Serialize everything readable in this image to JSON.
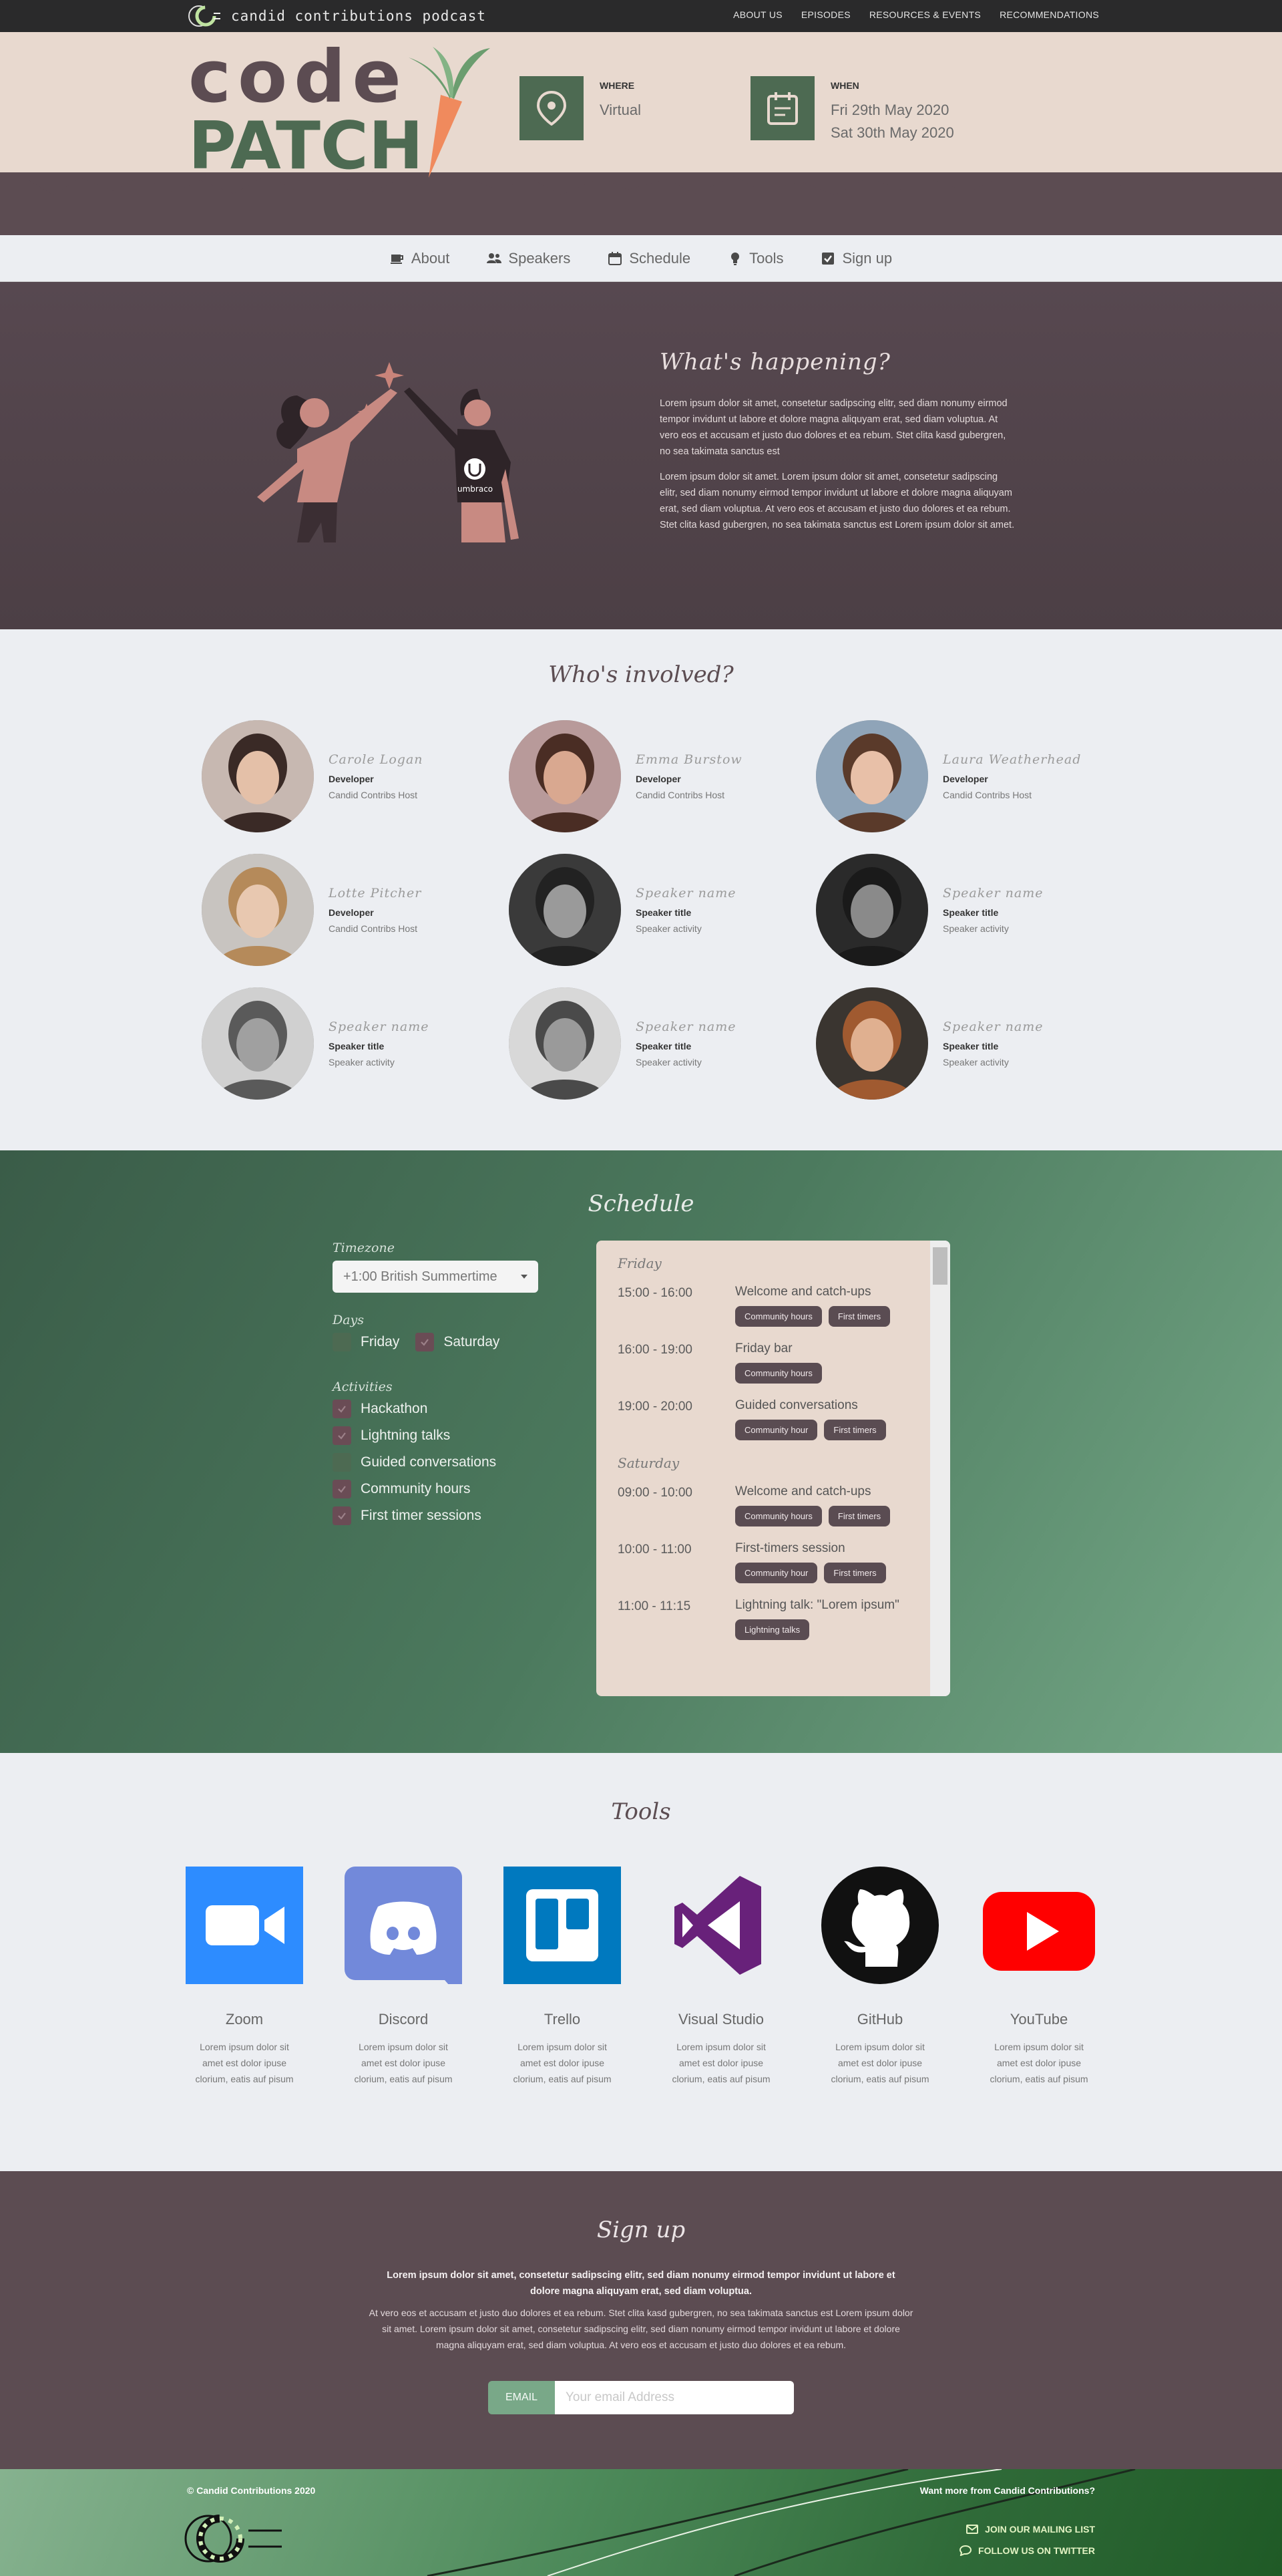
{
  "topbar": {
    "brand": "candid contributions podcast",
    "nav": [
      "About us",
      "Episodes",
      "Resources & events",
      "Recommendations"
    ]
  },
  "header": {
    "logo_text_1": "code",
    "logo_text_2": "PATCH",
    "where_label": "Where",
    "where_value": "Virtual",
    "when_label": "When",
    "when_values": [
      "Fri 29th May 2020",
      "Sat 30th May 2020"
    ]
  },
  "subnav": {
    "items": [
      {
        "label": "About",
        "icon": "coffee-icon"
      },
      {
        "label": "Speakers",
        "icon": "people-icon"
      },
      {
        "label": "Schedule",
        "icon": "calendar-icon"
      },
      {
        "label": "Tools",
        "icon": "bulb-icon"
      },
      {
        "label": "Sign up",
        "icon": "checkbox-icon"
      }
    ]
  },
  "happening": {
    "title": "What's happening?",
    "paragraphs": [
      "Lorem ipsum dolor sit amet, consetetur sadipscing elitr, sed diam nonumy eirmod tempor invidunt ut labore et dolore magna aliquyam erat, sed diam voluptua. At vero eos et accusam et justo duo dolores et ea rebum. Stet clita kasd gubergren, no sea takimata sanctus est",
      "Lorem ipsum dolor sit amet. Lorem ipsum dolor sit amet, consetetur sadipscing elitr, sed diam nonumy eirmod tempor invidunt ut labore et dolore magna aliquyam erat, sed diam voluptua. At vero eos et accusam et justo duo dolores et ea rebum. Stet clita kasd gubergren, no sea takimata sanctus est Lorem ipsum dolor sit amet."
    ],
    "shirt_text": "umbraco"
  },
  "involved": {
    "title": "Who's involved?",
    "speakers": [
      {
        "name": "Carole Logan",
        "title": "Developer",
        "activity": "Candid Contribs Host"
      },
      {
        "name": "Emma Burstow",
        "title": "Developer",
        "activity": "Candid Contribs Host"
      },
      {
        "name": "Laura Weatherhead",
        "title": "Developer",
        "activity": "Candid Contribs Host"
      },
      {
        "name": "Lotte Pitcher",
        "title": "Developer",
        "activity": "Candid Contribs Host"
      },
      {
        "name": "Speaker name",
        "title": "Speaker title",
        "activity": "Speaker activity"
      },
      {
        "name": "Speaker name",
        "title": "Speaker title",
        "activity": "Speaker activity"
      },
      {
        "name": "Speaker name",
        "title": "Speaker title",
        "activity": "Speaker activity"
      },
      {
        "name": "Speaker name",
        "title": "Speaker title",
        "activity": "Speaker activity"
      },
      {
        "name": "Speaker name",
        "title": "Speaker title",
        "activity": "Speaker activity"
      }
    ]
  },
  "schedule": {
    "title": "Schedule",
    "timezone_label": "Timezone",
    "timezone_value": "+1:00 British Summertime",
    "days_label": "Days",
    "days": [
      {
        "label": "Friday",
        "checked": false
      },
      {
        "label": "Saturday",
        "checked": true
      }
    ],
    "activities_label": "Activities",
    "activities": [
      {
        "label": "Hackathon",
        "checked": true
      },
      {
        "label": "Lightning talks",
        "checked": true
      },
      {
        "label": "Guided conversations",
        "checked": false
      },
      {
        "label": "Community hours",
        "checked": true
      },
      {
        "label": "First timer sessions",
        "checked": true
      }
    ],
    "friday_label": "Friday",
    "saturday_label": "Saturday",
    "friday": [
      {
        "time": "15:00 - 16:00",
        "title": "Welcome and catch-ups",
        "tags": [
          "Community hours",
          "First timers"
        ]
      },
      {
        "time": "16:00 - 19:00",
        "title": "Friday bar",
        "tags": [
          "Community hours"
        ]
      },
      {
        "time": "19:00 - 20:00",
        "title": "Guided conversations",
        "tags": [
          "Community hour",
          "First timers"
        ]
      }
    ],
    "saturday": [
      {
        "time": "09:00 - 10:00",
        "title": "Welcome and catch-ups",
        "tags": [
          "Community hours",
          "First timers"
        ]
      },
      {
        "time": "10:00 - 11:00",
        "title": "First-timers session",
        "tags": [
          "Community hour",
          "First timers"
        ]
      },
      {
        "time": "11:00 - 11:15",
        "title": "Lightning talk: \"Lorem ipsum\"",
        "tags": [
          "Lightning talks"
        ]
      }
    ]
  },
  "tools": {
    "title": "Tools",
    "items": [
      {
        "name": "Zoom",
        "desc": "Lorem ipsum dolor sit amet est dolor ipuse clorium, eatis auf pisum"
      },
      {
        "name": "Discord",
        "desc": "Lorem ipsum dolor sit amet est dolor ipuse clorium, eatis auf pisum"
      },
      {
        "name": "Trello",
        "desc": "Lorem ipsum dolor sit amet est dolor ipuse clorium, eatis auf pisum"
      },
      {
        "name": "Visual Studio",
        "desc": "Lorem ipsum dolor sit amet est dolor ipuse clorium, eatis auf pisum"
      },
      {
        "name": "GitHub",
        "desc": "Lorem ipsum dolor sit amet est dolor ipuse clorium, eatis auf pisum"
      },
      {
        "name": "YouTube",
        "desc": "Lorem ipsum dolor sit amet est dolor ipuse clorium, eatis auf pisum"
      }
    ]
  },
  "signup": {
    "title": "Sign up",
    "bold_text": "Lorem ipsum dolor sit amet, consetetur sadipscing elitr, sed diam nonumy eirmod tempor invidunt ut labore et dolore magna aliquyam erat, sed diam voluptua.",
    "text": "At vero eos et accusam et justo duo dolores et ea rebum. Stet clita kasd gubergren, no sea takimata sanctus est Lorem ipsum dolor sit amet. Lorem ipsum dolor sit amet, consetetur sadipscing elitr, sed diam nonumy eirmod tempor invidunt ut labore et dolore magna aliquyam erat, sed diam voluptua. At vero eos et accusam et justo duo dolores et ea rebum.",
    "email_label": "Email",
    "email_placeholder": "Your email Address"
  },
  "footer": {
    "copyright": "© Candid Contributions 2020",
    "more": "Want more from Candid Contributions?",
    "mailing": "Join our mailing list",
    "twitter": "Follow us on Twitter"
  },
  "colors": {
    "dark_plum": "#5c4c52",
    "sand": "#e8d9cf",
    "forest": "#4d6a52",
    "carrot": "#f08a5d",
    "light_bg": "#eceef2"
  }
}
